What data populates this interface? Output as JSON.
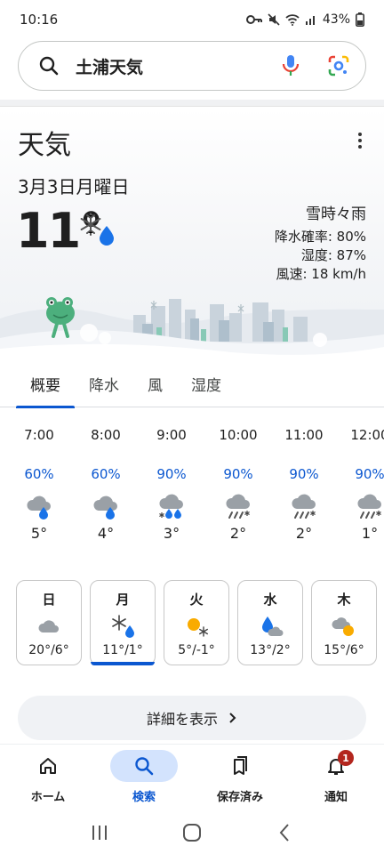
{
  "status_bar": {
    "time": "10:16",
    "battery": "43%"
  },
  "search": {
    "query": "土浦天気"
  },
  "weather": {
    "title": "天気",
    "date": "3月3日月曜日",
    "temperature": "11°",
    "condition": "雪時々雨",
    "precipitation": "降水確率: 80%",
    "humidity": "湿度: 87%",
    "wind": "風速: 18 km/h",
    "current_icon": "snow-rain-icon"
  },
  "tabs": [
    {
      "label": "概要",
      "active": true
    },
    {
      "label": "降水",
      "active": false
    },
    {
      "label": "風",
      "active": false
    },
    {
      "label": "湿度",
      "active": false
    }
  ],
  "hourly": [
    {
      "time": "7:00",
      "precip": "60%",
      "icon": "cloud-rain-icon",
      "temp": "5°"
    },
    {
      "time": "8:00",
      "precip": "60%",
      "icon": "cloud-rain-icon",
      "temp": "4°"
    },
    {
      "time": "9:00",
      "precip": "90%",
      "icon": "cloud-snow-rain-icon",
      "temp": "3°"
    },
    {
      "time": "10:00",
      "precip": "90%",
      "icon": "cloud-sleet-icon",
      "temp": "2°"
    },
    {
      "time": "11:00",
      "precip": "90%",
      "icon": "cloud-sleet-icon",
      "temp": "2°"
    },
    {
      "time": "12:00",
      "precip": "90%",
      "icon": "cloud-sleet-icon",
      "temp": "1°"
    }
  ],
  "daily": [
    {
      "day": "日",
      "icon": "cloudy-icon",
      "range": "20°/6°",
      "active": false
    },
    {
      "day": "月",
      "icon": "snow-rain-icon",
      "range": "11°/1°",
      "active": true
    },
    {
      "day": "火",
      "icon": "sun-snow-icon",
      "range": "5°/-1°",
      "active": false
    },
    {
      "day": "水",
      "icon": "rain-cloud-icon",
      "range": "13°/2°",
      "active": false
    },
    {
      "day": "木",
      "icon": "partly-sunny-icon",
      "range": "15°/6°",
      "active": false
    }
  ],
  "details_button": "詳細を表示",
  "bottom_nav": [
    {
      "label": "ホーム",
      "icon": "home-icon",
      "active": false
    },
    {
      "label": "検索",
      "icon": "search-icon",
      "active": true
    },
    {
      "label": "保存済み",
      "icon": "bookmarks-icon",
      "active": false
    },
    {
      "label": "通知",
      "icon": "bell-icon",
      "active": false,
      "badge": "1"
    }
  ],
  "colors": {
    "accent": "#0b57d0",
    "precip": "#0b57d0",
    "badge": "#b3261e",
    "rain_drop": "#1a73e8",
    "sun": "#f9ab00"
  }
}
